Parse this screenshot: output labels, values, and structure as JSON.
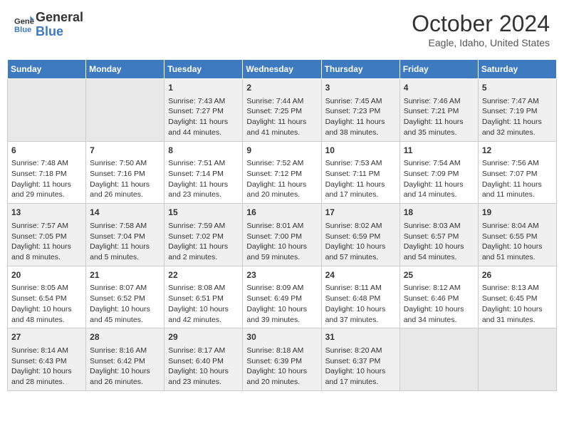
{
  "header": {
    "logo_line1": "General",
    "logo_line2": "Blue",
    "month_title": "October 2024",
    "location": "Eagle, Idaho, United States"
  },
  "weekdays": [
    "Sunday",
    "Monday",
    "Tuesday",
    "Wednesday",
    "Thursday",
    "Friday",
    "Saturday"
  ],
  "weeks": [
    [
      {
        "day": null,
        "sunrise": null,
        "sunset": null,
        "daylight": null
      },
      {
        "day": null,
        "sunrise": null,
        "sunset": null,
        "daylight": null
      },
      {
        "day": "1",
        "sunrise": "Sunrise: 7:43 AM",
        "sunset": "Sunset: 7:27 PM",
        "daylight": "Daylight: 11 hours and 44 minutes."
      },
      {
        "day": "2",
        "sunrise": "Sunrise: 7:44 AM",
        "sunset": "Sunset: 7:25 PM",
        "daylight": "Daylight: 11 hours and 41 minutes."
      },
      {
        "day": "3",
        "sunrise": "Sunrise: 7:45 AM",
        "sunset": "Sunset: 7:23 PM",
        "daylight": "Daylight: 11 hours and 38 minutes."
      },
      {
        "day": "4",
        "sunrise": "Sunrise: 7:46 AM",
        "sunset": "Sunset: 7:21 PM",
        "daylight": "Daylight: 11 hours and 35 minutes."
      },
      {
        "day": "5",
        "sunrise": "Sunrise: 7:47 AM",
        "sunset": "Sunset: 7:19 PM",
        "daylight": "Daylight: 11 hours and 32 minutes."
      }
    ],
    [
      {
        "day": "6",
        "sunrise": "Sunrise: 7:48 AM",
        "sunset": "Sunset: 7:18 PM",
        "daylight": "Daylight: 11 hours and 29 minutes."
      },
      {
        "day": "7",
        "sunrise": "Sunrise: 7:50 AM",
        "sunset": "Sunset: 7:16 PM",
        "daylight": "Daylight: 11 hours and 26 minutes."
      },
      {
        "day": "8",
        "sunrise": "Sunrise: 7:51 AM",
        "sunset": "Sunset: 7:14 PM",
        "daylight": "Daylight: 11 hours and 23 minutes."
      },
      {
        "day": "9",
        "sunrise": "Sunrise: 7:52 AM",
        "sunset": "Sunset: 7:12 PM",
        "daylight": "Daylight: 11 hours and 20 minutes."
      },
      {
        "day": "10",
        "sunrise": "Sunrise: 7:53 AM",
        "sunset": "Sunset: 7:11 PM",
        "daylight": "Daylight: 11 hours and 17 minutes."
      },
      {
        "day": "11",
        "sunrise": "Sunrise: 7:54 AM",
        "sunset": "Sunset: 7:09 PM",
        "daylight": "Daylight: 11 hours and 14 minutes."
      },
      {
        "day": "12",
        "sunrise": "Sunrise: 7:56 AM",
        "sunset": "Sunset: 7:07 PM",
        "daylight": "Daylight: 11 hours and 11 minutes."
      }
    ],
    [
      {
        "day": "13",
        "sunrise": "Sunrise: 7:57 AM",
        "sunset": "Sunset: 7:05 PM",
        "daylight": "Daylight: 11 hours and 8 minutes."
      },
      {
        "day": "14",
        "sunrise": "Sunrise: 7:58 AM",
        "sunset": "Sunset: 7:04 PM",
        "daylight": "Daylight: 11 hours and 5 minutes."
      },
      {
        "day": "15",
        "sunrise": "Sunrise: 7:59 AM",
        "sunset": "Sunset: 7:02 PM",
        "daylight": "Daylight: 11 hours and 2 minutes."
      },
      {
        "day": "16",
        "sunrise": "Sunrise: 8:01 AM",
        "sunset": "Sunset: 7:00 PM",
        "daylight": "Daylight: 10 hours and 59 minutes."
      },
      {
        "day": "17",
        "sunrise": "Sunrise: 8:02 AM",
        "sunset": "Sunset: 6:59 PM",
        "daylight": "Daylight: 10 hours and 57 minutes."
      },
      {
        "day": "18",
        "sunrise": "Sunrise: 8:03 AM",
        "sunset": "Sunset: 6:57 PM",
        "daylight": "Daylight: 10 hours and 54 minutes."
      },
      {
        "day": "19",
        "sunrise": "Sunrise: 8:04 AM",
        "sunset": "Sunset: 6:55 PM",
        "daylight": "Daylight: 10 hours and 51 minutes."
      }
    ],
    [
      {
        "day": "20",
        "sunrise": "Sunrise: 8:05 AM",
        "sunset": "Sunset: 6:54 PM",
        "daylight": "Daylight: 10 hours and 48 minutes."
      },
      {
        "day": "21",
        "sunrise": "Sunrise: 8:07 AM",
        "sunset": "Sunset: 6:52 PM",
        "daylight": "Daylight: 10 hours and 45 minutes."
      },
      {
        "day": "22",
        "sunrise": "Sunrise: 8:08 AM",
        "sunset": "Sunset: 6:51 PM",
        "daylight": "Daylight: 10 hours and 42 minutes."
      },
      {
        "day": "23",
        "sunrise": "Sunrise: 8:09 AM",
        "sunset": "Sunset: 6:49 PM",
        "daylight": "Daylight: 10 hours and 39 minutes."
      },
      {
        "day": "24",
        "sunrise": "Sunrise: 8:11 AM",
        "sunset": "Sunset: 6:48 PM",
        "daylight": "Daylight: 10 hours and 37 minutes."
      },
      {
        "day": "25",
        "sunrise": "Sunrise: 8:12 AM",
        "sunset": "Sunset: 6:46 PM",
        "daylight": "Daylight: 10 hours and 34 minutes."
      },
      {
        "day": "26",
        "sunrise": "Sunrise: 8:13 AM",
        "sunset": "Sunset: 6:45 PM",
        "daylight": "Daylight: 10 hours and 31 minutes."
      }
    ],
    [
      {
        "day": "27",
        "sunrise": "Sunrise: 8:14 AM",
        "sunset": "Sunset: 6:43 PM",
        "daylight": "Daylight: 10 hours and 28 minutes."
      },
      {
        "day": "28",
        "sunrise": "Sunrise: 8:16 AM",
        "sunset": "Sunset: 6:42 PM",
        "daylight": "Daylight: 10 hours and 26 minutes."
      },
      {
        "day": "29",
        "sunrise": "Sunrise: 8:17 AM",
        "sunset": "Sunset: 6:40 PM",
        "daylight": "Daylight: 10 hours and 23 minutes."
      },
      {
        "day": "30",
        "sunrise": "Sunrise: 8:18 AM",
        "sunset": "Sunset: 6:39 PM",
        "daylight": "Daylight: 10 hours and 20 minutes."
      },
      {
        "day": "31",
        "sunrise": "Sunrise: 8:20 AM",
        "sunset": "Sunset: 6:37 PM",
        "daylight": "Daylight: 10 hours and 17 minutes."
      },
      {
        "day": null,
        "sunrise": null,
        "sunset": null,
        "daylight": null
      },
      {
        "day": null,
        "sunrise": null,
        "sunset": null,
        "daylight": null
      }
    ]
  ]
}
